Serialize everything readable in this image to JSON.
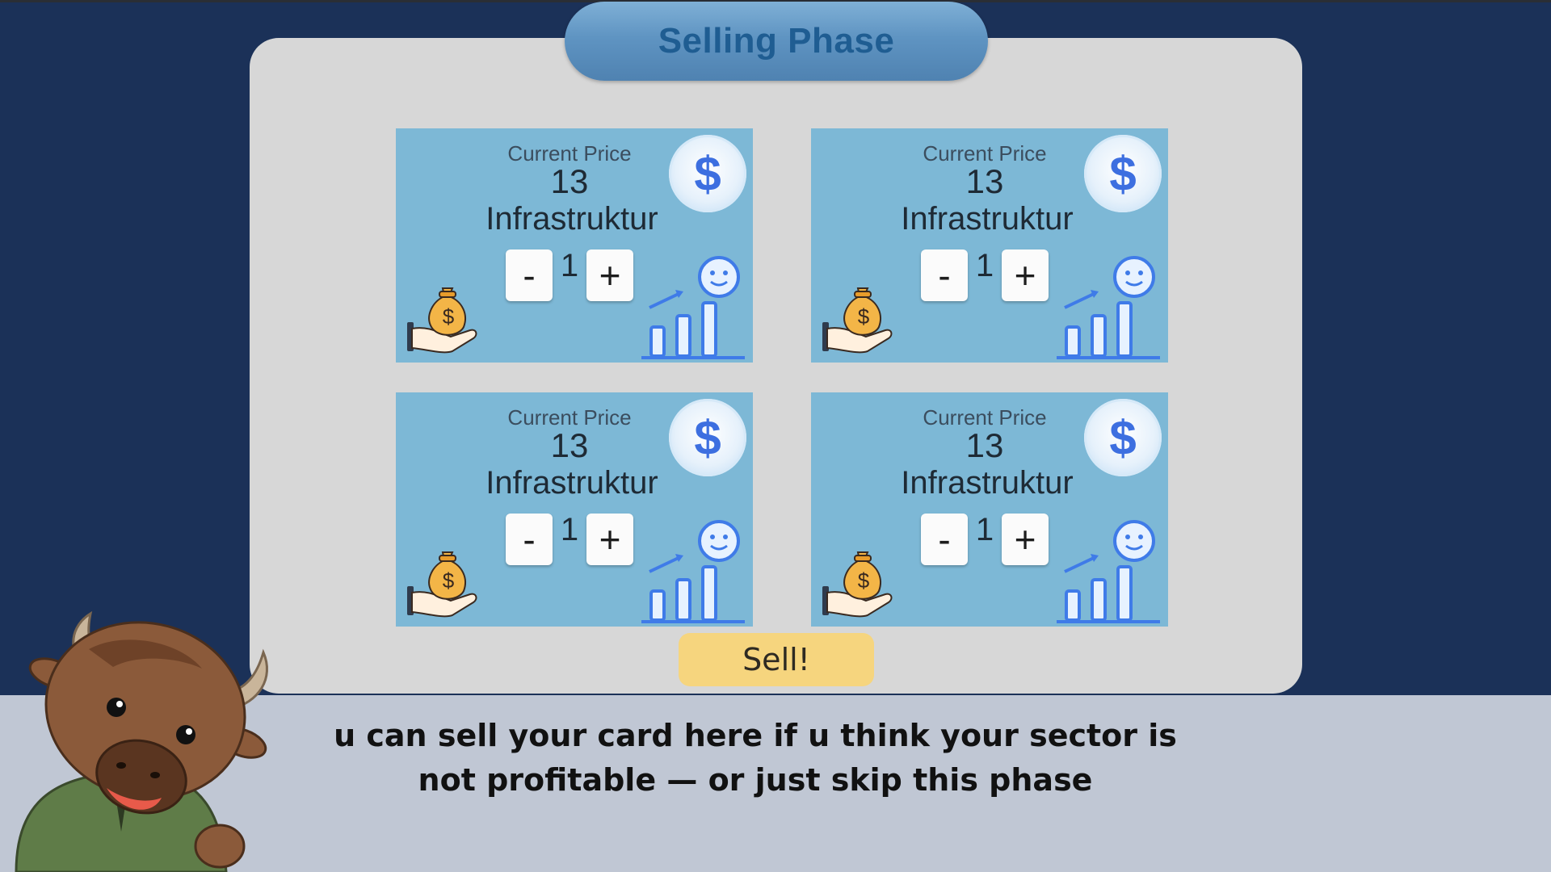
{
  "title": "Selling Phase",
  "cards": [
    {
      "label": "Current Price",
      "price": "13",
      "sector": "Infrastruktur",
      "quantity": "1",
      "minus": "-",
      "plus": "+"
    },
    {
      "label": "Current Price",
      "price": "13",
      "sector": "Infrastruktur",
      "quantity": "1",
      "minus": "-",
      "plus": "+"
    },
    {
      "label": "Current Price",
      "price": "13",
      "sector": "Infrastruktur",
      "quantity": "1",
      "minus": "-",
      "plus": "+"
    },
    {
      "label": "Current Price",
      "price": "13",
      "sector": "Infrastruktur",
      "quantity": "1",
      "minus": "-",
      "plus": "+"
    }
  ],
  "sell_button": "Sell!",
  "narration": {
    "line1": "u can sell your card here if u think your sector is",
    "line2": "not profitable — or just skip this phase"
  },
  "icons": {
    "coin": "dollar-coin-icon",
    "money": "money-bag-hand-icon",
    "growth": "growth-chart-icon",
    "mascot": "bull-mascot"
  },
  "colors": {
    "background": "#1b3158",
    "panel": "#d7d7d7",
    "card": "#7db8d6",
    "title_text": "#1f5d92",
    "sell_button": "#f6d57e",
    "narration_bar": "#c0c7d4"
  }
}
